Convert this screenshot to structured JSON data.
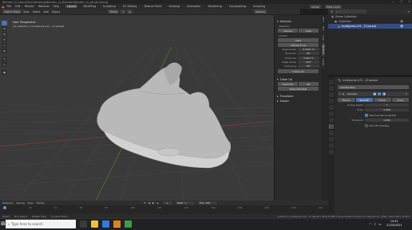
{
  "titlebar": {
    "title": "Blender [C:\\Users\\Teoh\\Desktop\\Blender_vs_Blender\\Blender_vs_ptruth.blend]",
    "minimize": "—",
    "maximize": "▢",
    "close": "✕"
  },
  "menubar": {
    "menus": [
      "File",
      "Edit",
      "Render",
      "Window",
      "Help"
    ],
    "workspaces": [
      "Layout",
      "Modeling",
      "Sculpting",
      "UV Editing",
      "Texture Paint",
      "Shading",
      "Animation",
      "Rendering",
      "Compositing",
      "Scripting"
    ],
    "active_workspace": "Layout",
    "scene": "Scene",
    "view_layer": "View Layer"
  },
  "viewport_header": {
    "mode": "Object Mode",
    "menus": [
      "View",
      "Select",
      "Add",
      "Object"
    ],
    "orientation": "Global",
    "options": "Options"
  },
  "viewport": {
    "view_name": "User Perspective",
    "collection_info": "(1) Collection | mudbynew a74 - 13 parsed",
    "tools": [
      "select-tool",
      "cursor-tool",
      "move-tool",
      "rotate-tool",
      "scale-tool",
      "transform-tool",
      "annotate-tool",
      "measure-tool",
      "add-cube-tool"
    ],
    "axis_labels": {
      "x": "X",
      "y": "Y",
      "z": "Z"
    }
  },
  "npanel": {
    "analysis_title": "Analysis",
    "statistics_title": "Statistics",
    "volume_label": "Volume",
    "area_label": "Area",
    "checks_title": "Checks",
    "solid_label": "Solid",
    "intersections_label": "Intersections",
    "checks": [
      {
        "name": "Degenerate",
        "value": "0.0001 m"
      },
      {
        "name": "Distorted",
        "value": "45°"
      },
      {
        "name": "Thickness",
        "value": "0.001 m"
      },
      {
        "name": "Edge Sharp",
        "value": "160°"
      },
      {
        "name": "Overhang",
        "value": "45°"
      }
    ],
    "check_all": "Check All",
    "cleanup_title": "Clean Up",
    "distorted_btn": "Distorted",
    "make_manifold": "Make Manifold",
    "transform_title": "Transform",
    "export_title": "Export",
    "tabs": [
      "3D-Print",
      "Item",
      "Tool",
      "View",
      "Create"
    ],
    "active_tab": "3D-Print"
  },
  "outliner": {
    "title": "Scene Collection",
    "items": [
      "Collection",
      "mudbynew a74 - 13 parsed"
    ]
  },
  "properties": {
    "object_name": "mudbynew a74 - 13 parsed",
    "add_modifier": "Add Modifier",
    "modifier_name": "Remesh",
    "modes": [
      "Blocks",
      "Smooth",
      "Sharp",
      "Voxel"
    ],
    "active_mode": "Smooth",
    "octree_label": "Octree Depth",
    "octree_value": "7",
    "scale_label": "Scale",
    "scale_value": "0.900",
    "remove_disconnected": "Remove Disconnected",
    "threshold_label": "Threshold",
    "threshold_value": "1.000",
    "smooth_shading": "Smooth Shading"
  },
  "timeline": {
    "menus": [
      "Playback",
      "Keying",
      "View",
      "Marker"
    ],
    "current_frame": "1",
    "start_label": "Start",
    "start_value": "1",
    "end_label": "End",
    "end_value": "250",
    "ticks": [
      "0",
      "20",
      "40",
      "60",
      "80",
      "100",
      "120",
      "140",
      "160",
      "180",
      "200",
      "220",
      "240"
    ]
  },
  "statusbar": {
    "left": "Select",
    "middle": "Box Select",
    "rotate": "Rotate View",
    "context": "Context Menu",
    "stats": "Collection | mudbynew a74 - 13 parsed | Verts:31,860 | Faces:31,862 | Tris:63,720 | Objects:1/1 | Mem: 189.3 MiB | v2.83.0"
  },
  "taskbar": {
    "search_placeholder": "Type here to search",
    "time": "14:41",
    "date": "21/05/2021"
  },
  "colors": {
    "accent": "#4772b3",
    "viewport_bg": "#3a3a3a",
    "grid": "#4a4a4a"
  }
}
